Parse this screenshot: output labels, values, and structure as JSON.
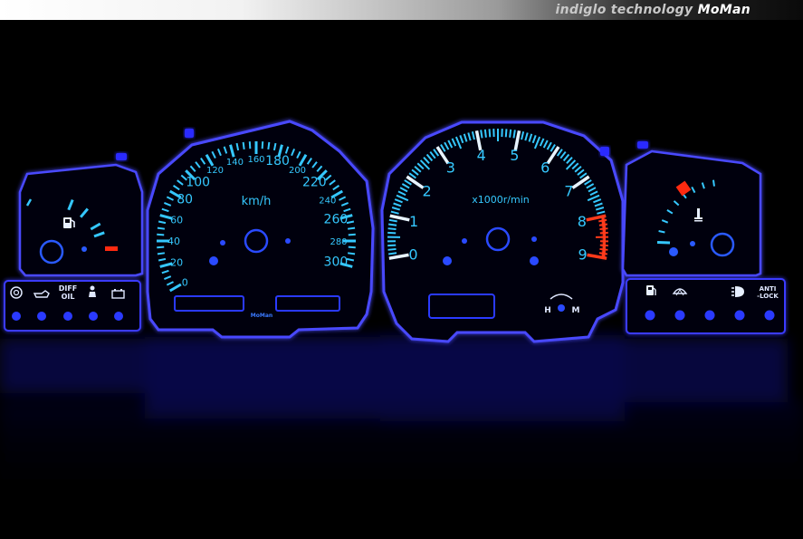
{
  "header": {
    "brand_text": "indiglo technology",
    "brand_name": "MoMan"
  },
  "speedometer": {
    "unit": "km/h",
    "logo": "MoMan",
    "labels": [
      "0",
      "20",
      "40",
      "60",
      "80",
      "100",
      "120",
      "140",
      "160",
      "180",
      "200",
      "220",
      "240",
      "260",
      "280",
      "300"
    ]
  },
  "tachometer": {
    "unit": "x1000r/min",
    "labels": [
      "0",
      "1",
      "2",
      "3",
      "4",
      "5",
      "6",
      "7",
      "8",
      "9"
    ],
    "redline_from": 8
  },
  "temp_gauge": {
    "low": "H",
    "high": "M",
    "icon": "thermometer-icon"
  },
  "fuel_gauge": {
    "icon": "fuel-pump-icon"
  },
  "warning_lights_left": {
    "items": [
      {
        "icon": "brake-warning-icon"
      },
      {
        "icon": "oil-pressure-icon"
      },
      {
        "label": "DIFF\nOIL",
        "line1": "DIFF",
        "line2": "OIL"
      },
      {
        "icon": "seatbelt-icon"
      },
      {
        "icon": "battery-icon"
      }
    ]
  },
  "warning_lights_right": {
    "items": [
      {
        "icon": "fuel-low-icon"
      },
      {
        "icon": "washer-icon"
      },
      {
        "icon": "headlight-icon"
      },
      {
        "label": "ANTI-LOCK",
        "line1": "ANTI",
        "line2": "-LOCK"
      }
    ]
  },
  "colors": {
    "glow": "#3a3aff",
    "numeral": "#35c8ff",
    "warning": "#ff2a10",
    "background": "#000000"
  }
}
